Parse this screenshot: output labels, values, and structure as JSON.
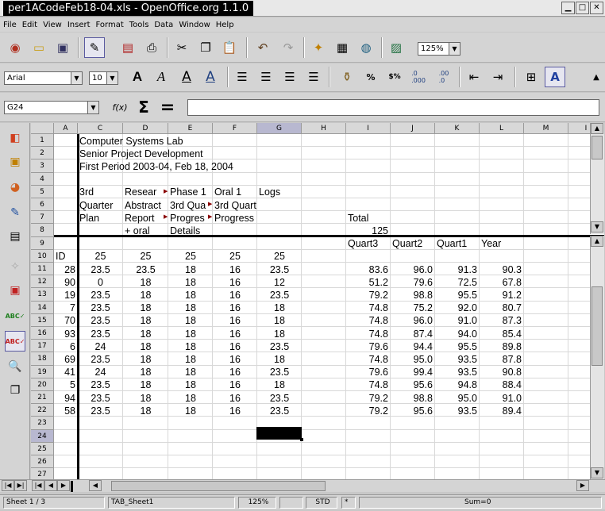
{
  "window": {
    "title": "per1ACodeFeb18-04.xls - OpenOffice.org 1.1.0"
  },
  "menu": [
    "File",
    "Edit",
    "View",
    "Insert",
    "Format",
    "Tools",
    "Data",
    "Window",
    "Help"
  ],
  "toolbar": {
    "zoom": "125%"
  },
  "format_bar": {
    "font": "Arial",
    "size": "10",
    "bold": "A",
    "italic": "A",
    "underline": "A",
    "shadow": "A",
    "percent": "%",
    "currency": "$%",
    "decimal_add": ".0\n.000",
    "decimal_del": ".00\n.0"
  },
  "formula_bar": {
    "cell_ref": "G24",
    "fx": "f(x)",
    "sum": "Σ",
    "equals": "=",
    "content": ""
  },
  "columns": [
    "A",
    "C",
    "D",
    "E",
    "F",
    "G",
    "H",
    "I",
    "J",
    "K",
    "L",
    "M"
  ],
  "rows": [
    "1",
    "2",
    "3",
    "4",
    "5",
    "6",
    "7",
    "8",
    "9",
    "10",
    "11",
    "12",
    "13",
    "14",
    "15",
    "16",
    "17",
    "18",
    "19",
    "20",
    "21",
    "22",
    "23",
    "24",
    "25",
    "26",
    "27"
  ],
  "cells": {
    "r1": "Computer Systems Lab",
    "r2": "Senior Project Development",
    "r3": "First Period 2003-04, Feb 18, 2004",
    "r5": [
      "3rd",
      "Resear",
      "Phase 1",
      "Oral 1",
      "Logs"
    ],
    "r6": [
      "Quarter",
      "Abstract",
      "3rd Qua",
      "3rd Quart"
    ],
    "r7": [
      "Plan",
      "Report",
      "Progres",
      "Progress",
      "Total"
    ],
    "r8": [
      "+ oral",
      "Details",
      "125"
    ],
    "r9": [
      "Quart3",
      "Quart2",
      "Quart1",
      "Year"
    ],
    "r10": [
      "ID",
      "25",
      "25",
      "25",
      "25",
      "25"
    ],
    "data": [
      [
        "28",
        "23.5",
        "23.5",
        "18",
        "16",
        "23.5",
        "83.6",
        "96.0",
        "91.3",
        "90.3"
      ],
      [
        "90",
        "0",
        "18",
        "18",
        "16",
        "12",
        "51.2",
        "79.6",
        "72.5",
        "67.8"
      ],
      [
        "19",
        "23.5",
        "18",
        "18",
        "16",
        "23.5",
        "79.2",
        "98.8",
        "95.5",
        "91.2"
      ],
      [
        "7",
        "23.5",
        "18",
        "18",
        "16",
        "18",
        "74.8",
        "75.2",
        "92.0",
        "80.7"
      ],
      [
        "70",
        "23.5",
        "18",
        "18",
        "16",
        "18",
        "74.8",
        "96.0",
        "91.0",
        "87.3"
      ],
      [
        "93",
        "23.5",
        "18",
        "18",
        "16",
        "18",
        "74.8",
        "87.4",
        "94.0",
        "85.4"
      ],
      [
        "6",
        "24",
        "18",
        "18",
        "16",
        "23.5",
        "79.6",
        "94.4",
        "95.5",
        "89.8"
      ],
      [
        "69",
        "23.5",
        "18",
        "18",
        "16",
        "18",
        "74.8",
        "95.0",
        "93.5",
        "87.8"
      ],
      [
        "41",
        "24",
        "18",
        "18",
        "16",
        "23.5",
        "79.6",
        "99.4",
        "93.5",
        "90.8"
      ],
      [
        "5",
        "23.5",
        "18",
        "18",
        "16",
        "18",
        "74.8",
        "95.6",
        "94.8",
        "88.4"
      ],
      [
        "94",
        "23.5",
        "18",
        "18",
        "16",
        "23.5",
        "79.2",
        "98.8",
        "95.0",
        "91.0"
      ],
      [
        "58",
        "23.5",
        "18",
        "18",
        "16",
        "23.5",
        "79.2",
        "95.6",
        "93.5",
        "89.4"
      ]
    ]
  },
  "status": {
    "sheet": "Sheet 1 / 3",
    "tab": "TAB_Sheet1",
    "zoom": "125%",
    "mode": "STD",
    "flag": "*",
    "sum": "Sum=0"
  }
}
